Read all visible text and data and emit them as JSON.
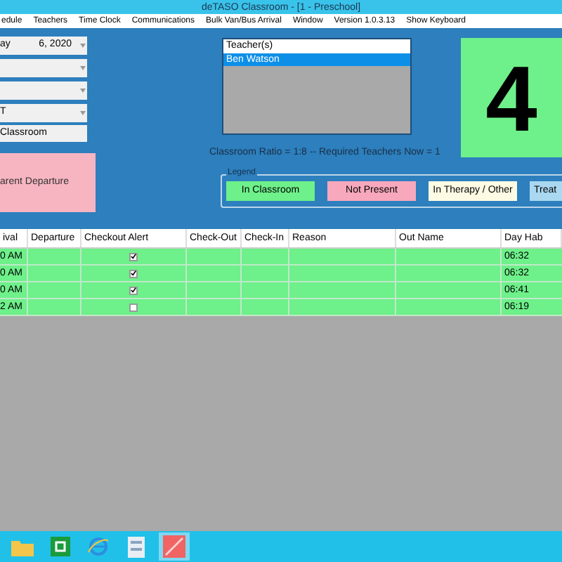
{
  "window": {
    "title": "deTASO Classroom - [1 - Preschool]"
  },
  "menu": [
    "edule",
    "Teachers",
    "Time Clock",
    "Communications",
    "Bulk Van/Bus Arrival",
    "Window",
    "Version 1.0.3.13",
    "Show Keyboard"
  ],
  "combos": [
    {
      "kind": "dropdown",
      "value": "ay",
      "value2": "6, 2020"
    },
    {
      "kind": "dropdown"
    },
    {
      "kind": "dropdown"
    },
    {
      "kind": "dropdown",
      "value": "T"
    }
  ],
  "classroom_field": "Classroom",
  "departure_button": "arent Departure",
  "teachers": {
    "header": "Teacher(s)",
    "items": [
      {
        "name": "Ben Watson",
        "selected": true
      }
    ]
  },
  "count": "4",
  "ratio_text": "Classroom Ratio = 1:8 -- Required Teachers Now = 1",
  "legend": {
    "title": "Legend",
    "items": [
      {
        "label": "In Classroom",
        "color": "#6ef08a"
      },
      {
        "label": "Not Present",
        "color": "#f7a8bc"
      },
      {
        "label": "In Therapy / Other",
        "color": "#fdfbe4"
      },
      {
        "label": "Treat",
        "color": "#a9d8f0"
      }
    ]
  },
  "table": {
    "columns": [
      "ival",
      "Departure",
      "Checkout Alert",
      "Check-Out",
      "Check-In",
      "Reason",
      "Out Name",
      "Day Hab"
    ],
    "rows": [
      {
        "arrival": "0 AM",
        "checked": true,
        "day_hab": "06:32"
      },
      {
        "arrival": "0 AM",
        "checked": true,
        "day_hab": "06:32"
      },
      {
        "arrival": "0 AM",
        "checked": true,
        "day_hab": "06:41"
      },
      {
        "arrival": "2 AM",
        "checked": false,
        "day_hab": "06:19"
      }
    ]
  },
  "taskbar": [
    {
      "kind": "folder",
      "selected": false
    },
    {
      "kind": "store",
      "selected": false
    },
    {
      "kind": "browser",
      "selected": false
    },
    {
      "kind": "document",
      "selected": false
    },
    {
      "kind": "app",
      "selected": true
    }
  ]
}
